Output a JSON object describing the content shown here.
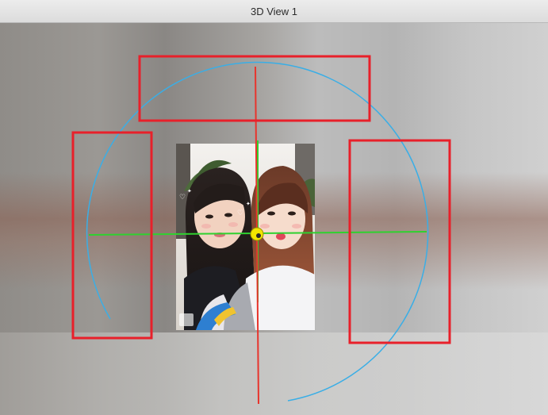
{
  "window": {
    "title": "3D View 1"
  },
  "colors": {
    "rotation_ring": "#3aaee6",
    "axis_x": "#2fd12f",
    "axis_y": "#2fd12f",
    "axis_z": "#e8342c",
    "highlight_boxes": "#e8202a",
    "gizmo_center": "#f2e500"
  },
  "scene": {
    "image_plane": {
      "icon": "selfie-photo-plane",
      "watermark_text": ""
    },
    "gizmo": {
      "type": "rotation-translation",
      "icon": "transform-gizmo-icon"
    }
  }
}
